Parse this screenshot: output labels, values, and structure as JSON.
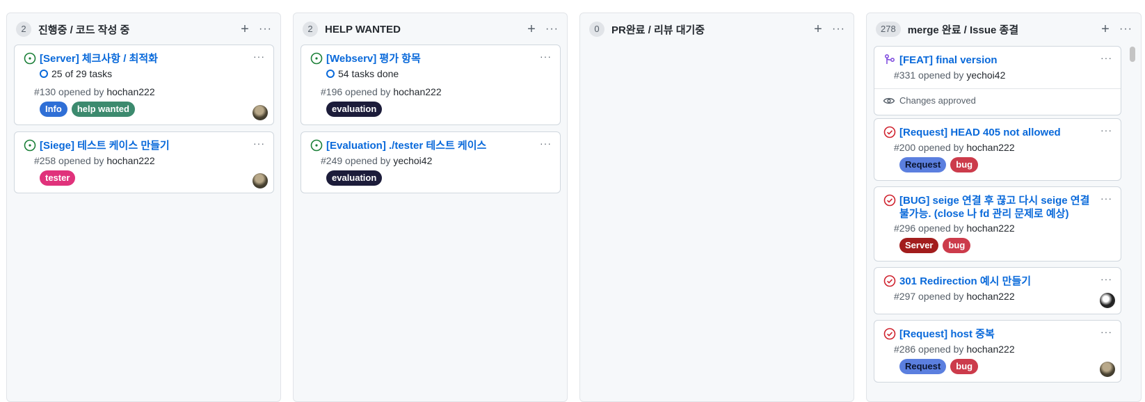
{
  "columns": [
    {
      "count": "2",
      "title": "진행중 / 코드 작성 중",
      "cards": [
        {
          "title": "[Server] 체크사항 / 최적화",
          "tasks": "25 of 29 tasks",
          "meta_prefix": "#130 opened by ",
          "user": "hochan222",
          "labels": [
            "Info",
            "help wanted"
          ],
          "state": "open"
        },
        {
          "title": "[Siege] 테스트 케이스 만들기",
          "meta_prefix": "#258 opened by ",
          "user": "hochan222",
          "labels": [
            "tester"
          ],
          "state": "open"
        }
      ]
    },
    {
      "count": "2",
      "title": "HELP WANTED",
      "cards": [
        {
          "title": "[Webserv] 평가 항목",
          "tasks": "54 tasks done",
          "meta_prefix": "#196 opened by ",
          "user": "hochan222",
          "labels": [
            "evaluation"
          ],
          "state": "open"
        },
        {
          "title": "[Evaluation] ./tester 테스트 케이스",
          "meta_prefix": "#249 opened by ",
          "user": "yechoi42",
          "labels": [
            "evaluation"
          ],
          "state": "open"
        }
      ]
    },
    {
      "count": "0",
      "title": "PR완료 / 리뷰 대기중",
      "cards": []
    },
    {
      "count": "278",
      "title": "merge 완료 / Issue 종결",
      "cards": [
        {
          "title": "[FEAT] final version",
          "meta_prefix": "#331 opened by ",
          "user": "yechoi42",
          "review": "Changes approved",
          "state": "merged"
        },
        {
          "title": "[Request] HEAD 405 not allowed",
          "meta_prefix": "#200 opened by ",
          "user": "hochan222",
          "labels": [
            "Request",
            "bug"
          ],
          "state": "closed"
        },
        {
          "title": "[BUG] seige 연결 후 끊고 다시 seige 연결 불가능. (close 나 fd 관리 문제로 예상)",
          "meta_prefix": "#296 opened by ",
          "user": "hochan222",
          "labels": [
            "Server",
            "bug"
          ],
          "state": "closed"
        },
        {
          "title": "301 Redirection 예시 만들기",
          "meta_prefix": "#297 opened by ",
          "user": "hochan222",
          "state": "closed"
        },
        {
          "title": "[Request] host 중복",
          "meta_prefix": "#286 opened by ",
          "user": "hochan222",
          "labels": [
            "Request",
            "bug"
          ],
          "state": "closed"
        }
      ]
    }
  ],
  "icons": {
    "add": "plus-icon",
    "more": "kebab-horizontal-icon",
    "open": "issue-opened-icon",
    "closed": "issue-closed-icon",
    "merged": "git-merge-icon",
    "review": "eye-icon",
    "tasks": "progress-ring-icon"
  },
  "symbols": {
    "plus": "+",
    "more": "···"
  },
  "colors": {
    "open": "#1a7f37",
    "closed": "#cf222e",
    "merged": "#8250df",
    "link": "#0969da",
    "label_Info": "#2f6fd6",
    "label_help_wanted": "#3c8a6e",
    "label_tester": "#e0327b",
    "label_evaluation": "#1c1c3a",
    "label_Request": "#5b7fdf",
    "label_bug": "#cc3b4b",
    "label_Server": "#a21d1d"
  }
}
